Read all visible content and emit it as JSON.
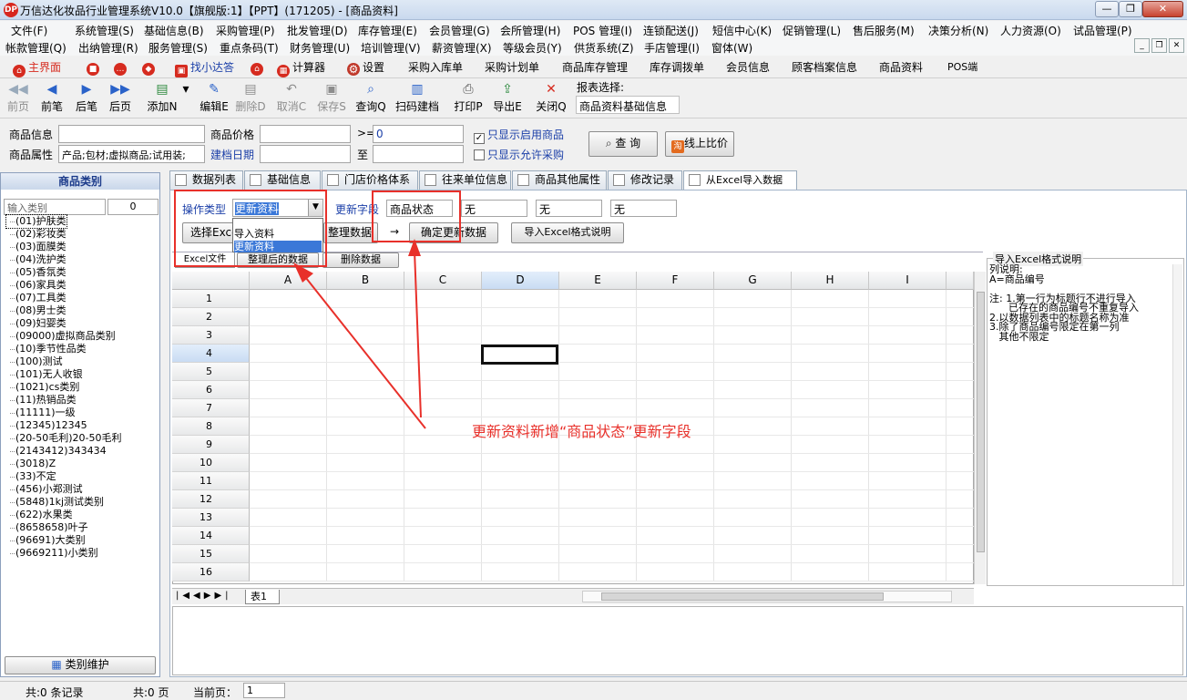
{
  "window": {
    "title": "万信达化妆品行业管理系统V10.0【旗舰版:1】【PPT】(171205) - [商品资料]",
    "logo_text": "DP"
  },
  "menu_row1": [
    "文件(F)",
    "系统管理(S)",
    "基础信息(B)",
    "采购管理(P)",
    "批发管理(D)",
    "库存管理(E)",
    "会员管理(G)",
    "会所管理(H)",
    "POS 管理(I)",
    "连锁配送(J)",
    "短信中心(K)",
    "促销管理(L)",
    "售后服务(M)",
    "决策分析(N)",
    "人力资源(O)",
    "试品管理(P)"
  ],
  "menu_row2": [
    "帐款管理(Q)",
    "出纳管理(R)",
    "服务管理(S)",
    "重点条码(T)",
    "财务管理(U)",
    "培训管理(V)",
    "薪资管理(X)",
    "等级会员(Y)",
    "供货系统(Z)",
    "手店管理(I)",
    "窗体(W)"
  ],
  "quickbar": {
    "items": [
      {
        "label": "主界面",
        "icon": "home-red-icon"
      },
      {
        "label": "",
        "icon": "lock-icon"
      },
      {
        "label": "",
        "icon": "chat-icon"
      },
      {
        "label": "",
        "icon": "shield-icon"
      },
      {
        "label": "找小达答",
        "icon": "tv-icon"
      },
      {
        "label": "",
        "icon": "house-icon"
      },
      {
        "label": "计算器",
        "icon": "calculator-icon"
      },
      {
        "label": "设置",
        "icon": "gear-icon"
      }
    ],
    "links": [
      "采购入库单",
      "采购计划单",
      "商品库存管理",
      "库存调拨单",
      "会员信息",
      "顾客档案信息",
      "商品资料",
      "POS端"
    ]
  },
  "toolbar": {
    "buttons": [
      {
        "label": "前页",
        "enabled": false
      },
      {
        "label": "前笔",
        "enabled": true
      },
      {
        "label": "后笔",
        "enabled": true
      },
      {
        "label": "后页",
        "enabled": true
      },
      {
        "label": "添加N",
        "enabled": true
      },
      {
        "label": "编辑E",
        "enabled": true
      },
      {
        "label": "删除D",
        "enabled": false
      },
      {
        "label": "取消C",
        "enabled": false
      },
      {
        "label": "保存S",
        "enabled": false
      },
      {
        "label": "查询Q",
        "enabled": true
      },
      {
        "label": "扫码建档",
        "enabled": true
      },
      {
        "label": "打印P",
        "enabled": true
      },
      {
        "label": "导出E",
        "enabled": true
      },
      {
        "label": "关闭Q",
        "enabled": true
      }
    ],
    "report_select_label": "报表选择:",
    "report_select_value": "商品资料基础信息"
  },
  "filters": {
    "product_info_label": "商品信息",
    "product_info_value": "",
    "price_label": "商品价格",
    "price_min": "",
    "gte_symbol": ">=",
    "price_max": "0",
    "only_enabled_label": "只显示启用商品",
    "only_enabled_checked": true,
    "attr_label": "商品属性",
    "attr_value": "产品;包材;虚拟商品;试用装;",
    "date_label": "建档日期",
    "date_from": "",
    "date_to_label": "至",
    "date_to": "",
    "only_purchase_label": "只显示允许采购",
    "only_purchase_checked": false,
    "query_button": "查 询",
    "compare_button": "线上比价"
  },
  "left_panel": {
    "title": "商品类别",
    "search_placeholder": "输入类别",
    "search_count": "0",
    "categories": [
      "(01)护肤类",
      "(02)彩妆类",
      "(03)面膜类",
      "(04)洗护类",
      "(05)香氛类",
      "(06)家具类",
      "(07)工具类",
      "(08)男士类",
      "(09)妇婴类",
      "(09000)虚拟商品类别",
      "(10)季节性品类",
      "(100)测试",
      "(101)无人收银",
      "(1021)cs类别",
      "(11)热销品类",
      "(11111)一级",
      "(12345)12345",
      "(20-50毛利)20-50毛利",
      "(2143412)343434",
      "(3018)Z",
      "(33)不定",
      "(456)小郑测试",
      "(5848)1kj测试类别",
      "(622)水果类",
      "(8658658)叶子",
      "(96691)大类别",
      "(9669211)小类别"
    ],
    "maintain_button": "类别维护"
  },
  "tabs": [
    "数据列表",
    "基础信息",
    "门店价格体系",
    "往来单位信息",
    "商品其他属性",
    "修改记录",
    "从Excel导入数据"
  ],
  "import": {
    "op_type_label": "操作类型",
    "op_type_value": "更新资料",
    "dropdown_options": [
      "导入资料",
      "更新资料"
    ],
    "update_field_label": "更新字段",
    "update_fields": [
      "商品状态",
      "无",
      "无",
      "无"
    ],
    "select_excel_button": "选择Exce",
    "organize_button": "整理数据",
    "arrow": "→",
    "confirm_update_button": "确定更新数据",
    "format_help_button": "导入Excel格式说明",
    "subtab_excel": "Excel文件",
    "subtab_organized": "整理后的数据",
    "delete_button": "删除数据"
  },
  "sheet": {
    "columns": [
      "A",
      "B",
      "C",
      "D",
      "E",
      "F",
      "G",
      "H",
      "I"
    ],
    "rows": [
      "1",
      "2",
      "3",
      "4",
      "5",
      "6",
      "7",
      "8",
      "9",
      "10",
      "11",
      "12",
      "13",
      "14",
      "15",
      "16"
    ],
    "selected_cell": "D4",
    "sheet_tab": "表1"
  },
  "help_panel": {
    "title": "导入Excel格式说明",
    "lines": [
      "列说明:",
      "A=商品编号",
      "",
      "注: 1.第一行为标题行不进行导入",
      "      已存在的商品编号不重复导入",
      "2.以数据列表中的标题名称为准",
      "3.除了商品编号限定在第一列",
      "   其他不限定"
    ]
  },
  "annotation": {
    "text": "更新资料新增“商品状态”更新字段",
    "color": "#e8302a"
  },
  "status": {
    "records": "共:0 条记录",
    "pages": "共:0 页",
    "current_page_label": "当前页：",
    "current_page": "1"
  }
}
